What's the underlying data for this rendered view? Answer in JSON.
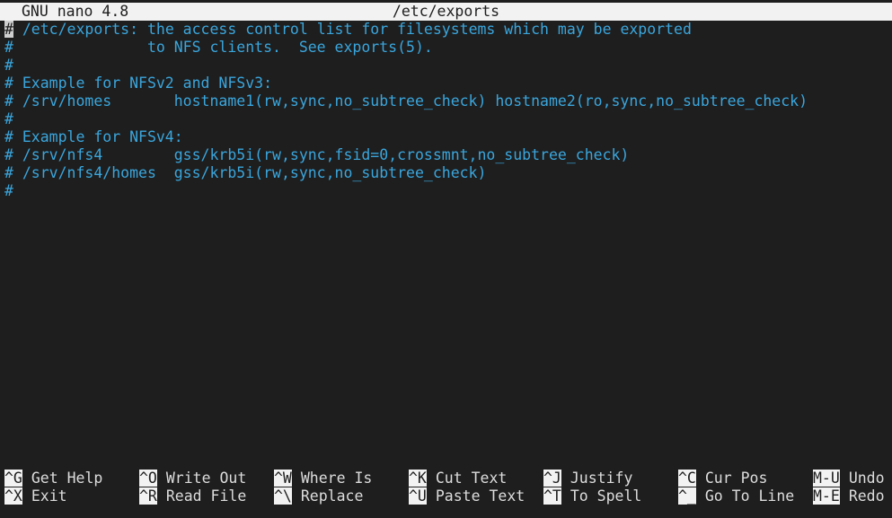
{
  "titlebar": {
    "app": "GNU nano 4.8",
    "filename": "/etc/exports"
  },
  "editor": {
    "lines": [
      "# /etc/exports: the access control list for filesystems which may be exported",
      "#               to NFS clients.  See exports(5).",
      "#",
      "# Example for NFSv2 and NFSv3:",
      "# /srv/homes       hostname1(rw,sync,no_subtree_check) hostname2(ro,sync,no_subtree_check)",
      "#",
      "# Example for NFSv4:",
      "# /srv/nfs4        gss/krb5i(rw,sync,fsid=0,crossmnt,no_subtree_check)",
      "# /srv/nfs4/homes  gss/krb5i(rw,sync,no_subtree_check)",
      "#"
    ],
    "cursor_char": "#",
    "text_color": "#3aa6dd"
  },
  "shortcuts": {
    "row1": [
      {
        "key": "^G",
        "label": "Get Help"
      },
      {
        "key": "^O",
        "label": "Write Out"
      },
      {
        "key": "^W",
        "label": "Where Is"
      },
      {
        "key": "^K",
        "label": "Cut Text"
      },
      {
        "key": "^J",
        "label": "Justify"
      },
      {
        "key": "^C",
        "label": "Cur Pos"
      },
      {
        "key": "M-U",
        "label": "Undo"
      }
    ],
    "row2": [
      {
        "key": "^X",
        "label": "Exit"
      },
      {
        "key": "^R",
        "label": "Read File"
      },
      {
        "key": "^\\",
        "label": "Replace"
      },
      {
        "key": "^U",
        "label": "Paste Text"
      },
      {
        "key": "^T",
        "label": "To Spell"
      },
      {
        "key": "^_",
        "label": "Go To Line"
      },
      {
        "key": "M-E",
        "label": "Redo"
      }
    ]
  }
}
